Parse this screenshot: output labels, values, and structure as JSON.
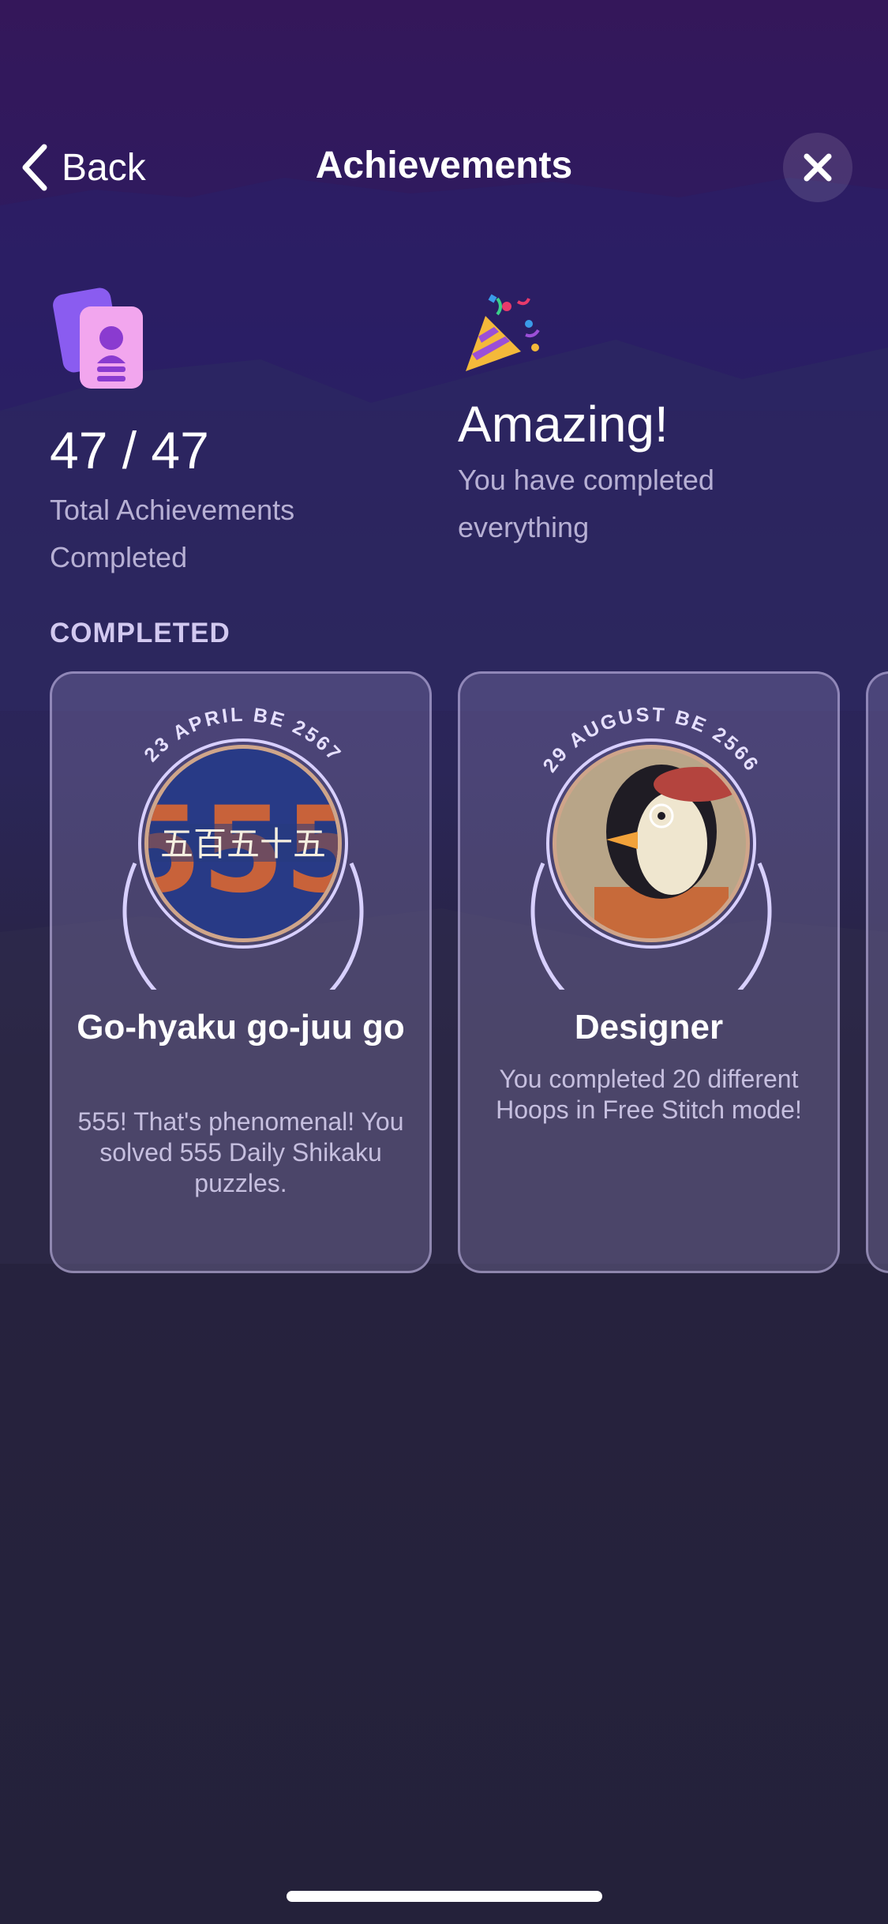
{
  "nav": {
    "back_label": "Back",
    "title": "Achievements",
    "back_icon": "chevron-left-icon",
    "close_icon": "close-icon"
  },
  "summary": {
    "count": "47 / 47",
    "count_caption": "Total Achievements Completed",
    "count_icon": "achievement-cards-icon",
    "headline": "Amazing!",
    "headline_caption": "You have completed everything",
    "headline_icon": "party-popper-icon"
  },
  "section": {
    "label": "COMPLETED"
  },
  "achievements": [
    {
      "date": "23 APRIL BE 2567",
      "badge_text": "五百五十五",
      "badge_number": "555",
      "title": "Go-hyaku go-juu go",
      "description": "555! That's phenomenal! You solved 555 Daily Shikaku puzzles."
    },
    {
      "date": "29 AUGUST BE 2566",
      "title": "Designer",
      "description": "You completed 20 different Hoops in Free Stitch mode!"
    }
  ],
  "colors": {
    "background_top": "#34175a",
    "background_bottom": "#24213a",
    "accent_text": "#b7b0d4",
    "card_border": "#c8beeb"
  }
}
